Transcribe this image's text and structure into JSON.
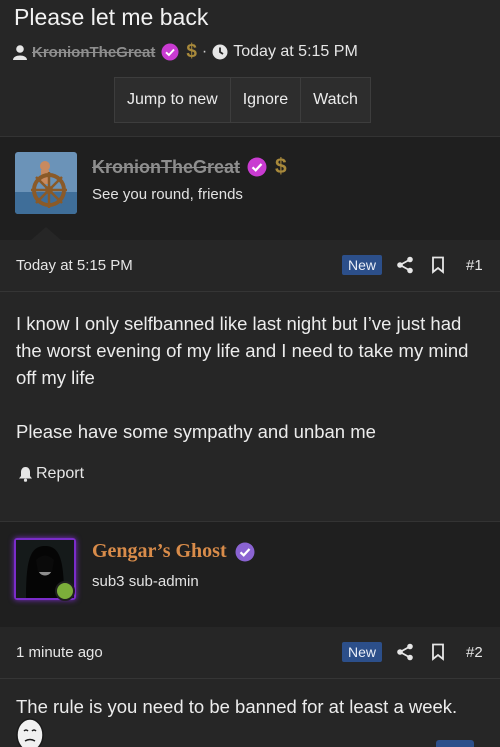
{
  "thread": {
    "title": "Please let me back",
    "author": "KronionTheGreat",
    "separator": "·",
    "time": "Today at 5:15 PM",
    "buttons": {
      "jump_to_new": "Jump to new",
      "ignore": "Ignore",
      "watch": "Watch"
    }
  },
  "posts": [
    {
      "author": "KronionTheGreat",
      "user_title": "See you round, friends",
      "date": "Today at 5:15 PM",
      "badge": "New",
      "number": "#1",
      "body": [
        "I know I only selfbanned like last night but I’ve just had the worst evening of my life and I need to take my mind off my life",
        "Please have some sympathy and unban me"
      ],
      "report_label": "Report"
    },
    {
      "author": "Gengar’s Ghost",
      "user_title": "sub3 sub-admin",
      "date": "1 minute ago",
      "badge": "New",
      "number": "#2",
      "body": [
        "The rule is you need to be banned for at least a week."
      ]
    }
  ],
  "colors": {
    "background": "#262626",
    "user_bar": "#1f1f1f",
    "badge": "#2c4f8a",
    "verified_pink": "#c93bd1",
    "verified_purple": "#8a63d2",
    "gengar_name": "#d98c4a",
    "online": "#7cae3a"
  }
}
